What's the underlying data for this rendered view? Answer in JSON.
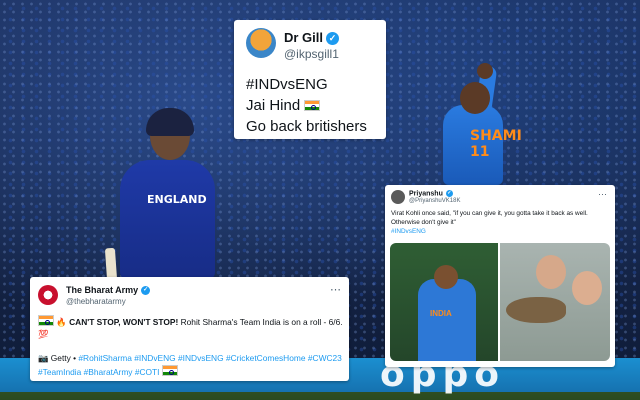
{
  "background": {
    "ad_board_text": "oppo",
    "england_jersey_text": "ENGLAND",
    "india_jersey_text": "SHAMI",
    "india_jersey_number": "11"
  },
  "tweets": [
    {
      "id": "gill",
      "author_name": "Dr Gill",
      "handle": "@ikpsgill1",
      "verified": true,
      "hashtag": "#INDvsENG",
      "lines": [
        "Jai Hind",
        "Go back britishers"
      ]
    },
    {
      "id": "priyanshu",
      "author_name": "Priyanshu",
      "handle": "@PriyanshuVK18K",
      "verified": true,
      "more_icon": "more-icon",
      "text": "Virat Kohli once said, \"if you can give it, you gotta take it back as well. Otherwise don't give it\"",
      "hashtag": "#INDvsENG",
      "media_caption_left": "INDIA"
    },
    {
      "id": "bharat-army",
      "author_name": "The Bharat Army",
      "handle": "@thebharatarmy",
      "verified": true,
      "more_icon": "more-icon",
      "headline": "CAN'T STOP, WON'T STOP!",
      "text": "Rohit Sharma's Team India is on a roll - 6/6.",
      "hundred_emoji": "💯",
      "credit_icon": "📷",
      "credit": "Getty •",
      "fire_emoji": "🔥",
      "hashtags": [
        "#RohitSharma",
        "#INDvENG",
        "#INDvsENG",
        "#CricketComesHome",
        "#CWC23",
        "#TeamIndia",
        "#BharatArmy",
        "#COTI"
      ]
    }
  ],
  "colors": {
    "link": "#1d9bf0",
    "verified": "#1d9bf0",
    "text": "#0f1419",
    "muted": "#536471"
  }
}
